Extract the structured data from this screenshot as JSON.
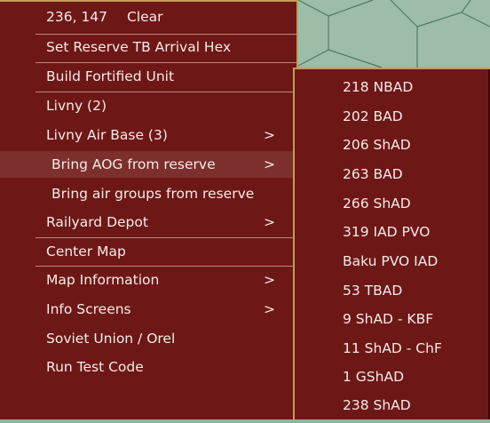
{
  "header": {
    "coords": "236, 147",
    "clear": "Clear"
  },
  "main_menu": [
    {
      "label": "Set Reserve TB Arrival Hex",
      "arrow": ""
    },
    {
      "label": "Build Fortified Unit",
      "arrow": ""
    },
    {
      "label": "Livny (2)",
      "arrow": ""
    },
    {
      "label": "Livny Air Base (3)",
      "arrow": ">"
    },
    {
      "label": "Bring AOG from reserve",
      "arrow": ">"
    },
    {
      "label": "Bring air groups from reserve",
      "arrow": ""
    },
    {
      "label": "Railyard Depot",
      "arrow": ">"
    },
    {
      "label": "Center Map",
      "arrow": ""
    },
    {
      "label": "Map Information",
      "arrow": ">"
    },
    {
      "label": "Info Screens",
      "arrow": ">"
    },
    {
      "label": "Soviet Union / Orel",
      "arrow": ""
    },
    {
      "label": "Run Test Code",
      "arrow": ""
    }
  ],
  "sub_menu": [
    {
      "label": "218 NBAD"
    },
    {
      "label": "202 BAD"
    },
    {
      "label": "206 ShAD"
    },
    {
      "label": "263 BAD"
    },
    {
      "label": "266 ShAD"
    },
    {
      "label": "319 IAD PVO"
    },
    {
      "label": "Baku PVO IAD"
    },
    {
      "label": "53 TBAD"
    },
    {
      "label": "9 ShAD - KBF"
    },
    {
      "label": "11 ShAD - ChF"
    },
    {
      "label": "1 GShAD"
    },
    {
      "label": "238 ShAD"
    }
  ],
  "colors": {
    "menu_bg": "#6e1717",
    "hover_bg": "#7c2f2c",
    "border": "#c49a5a",
    "text": "#f3ece6",
    "map": "#9dbda6"
  }
}
